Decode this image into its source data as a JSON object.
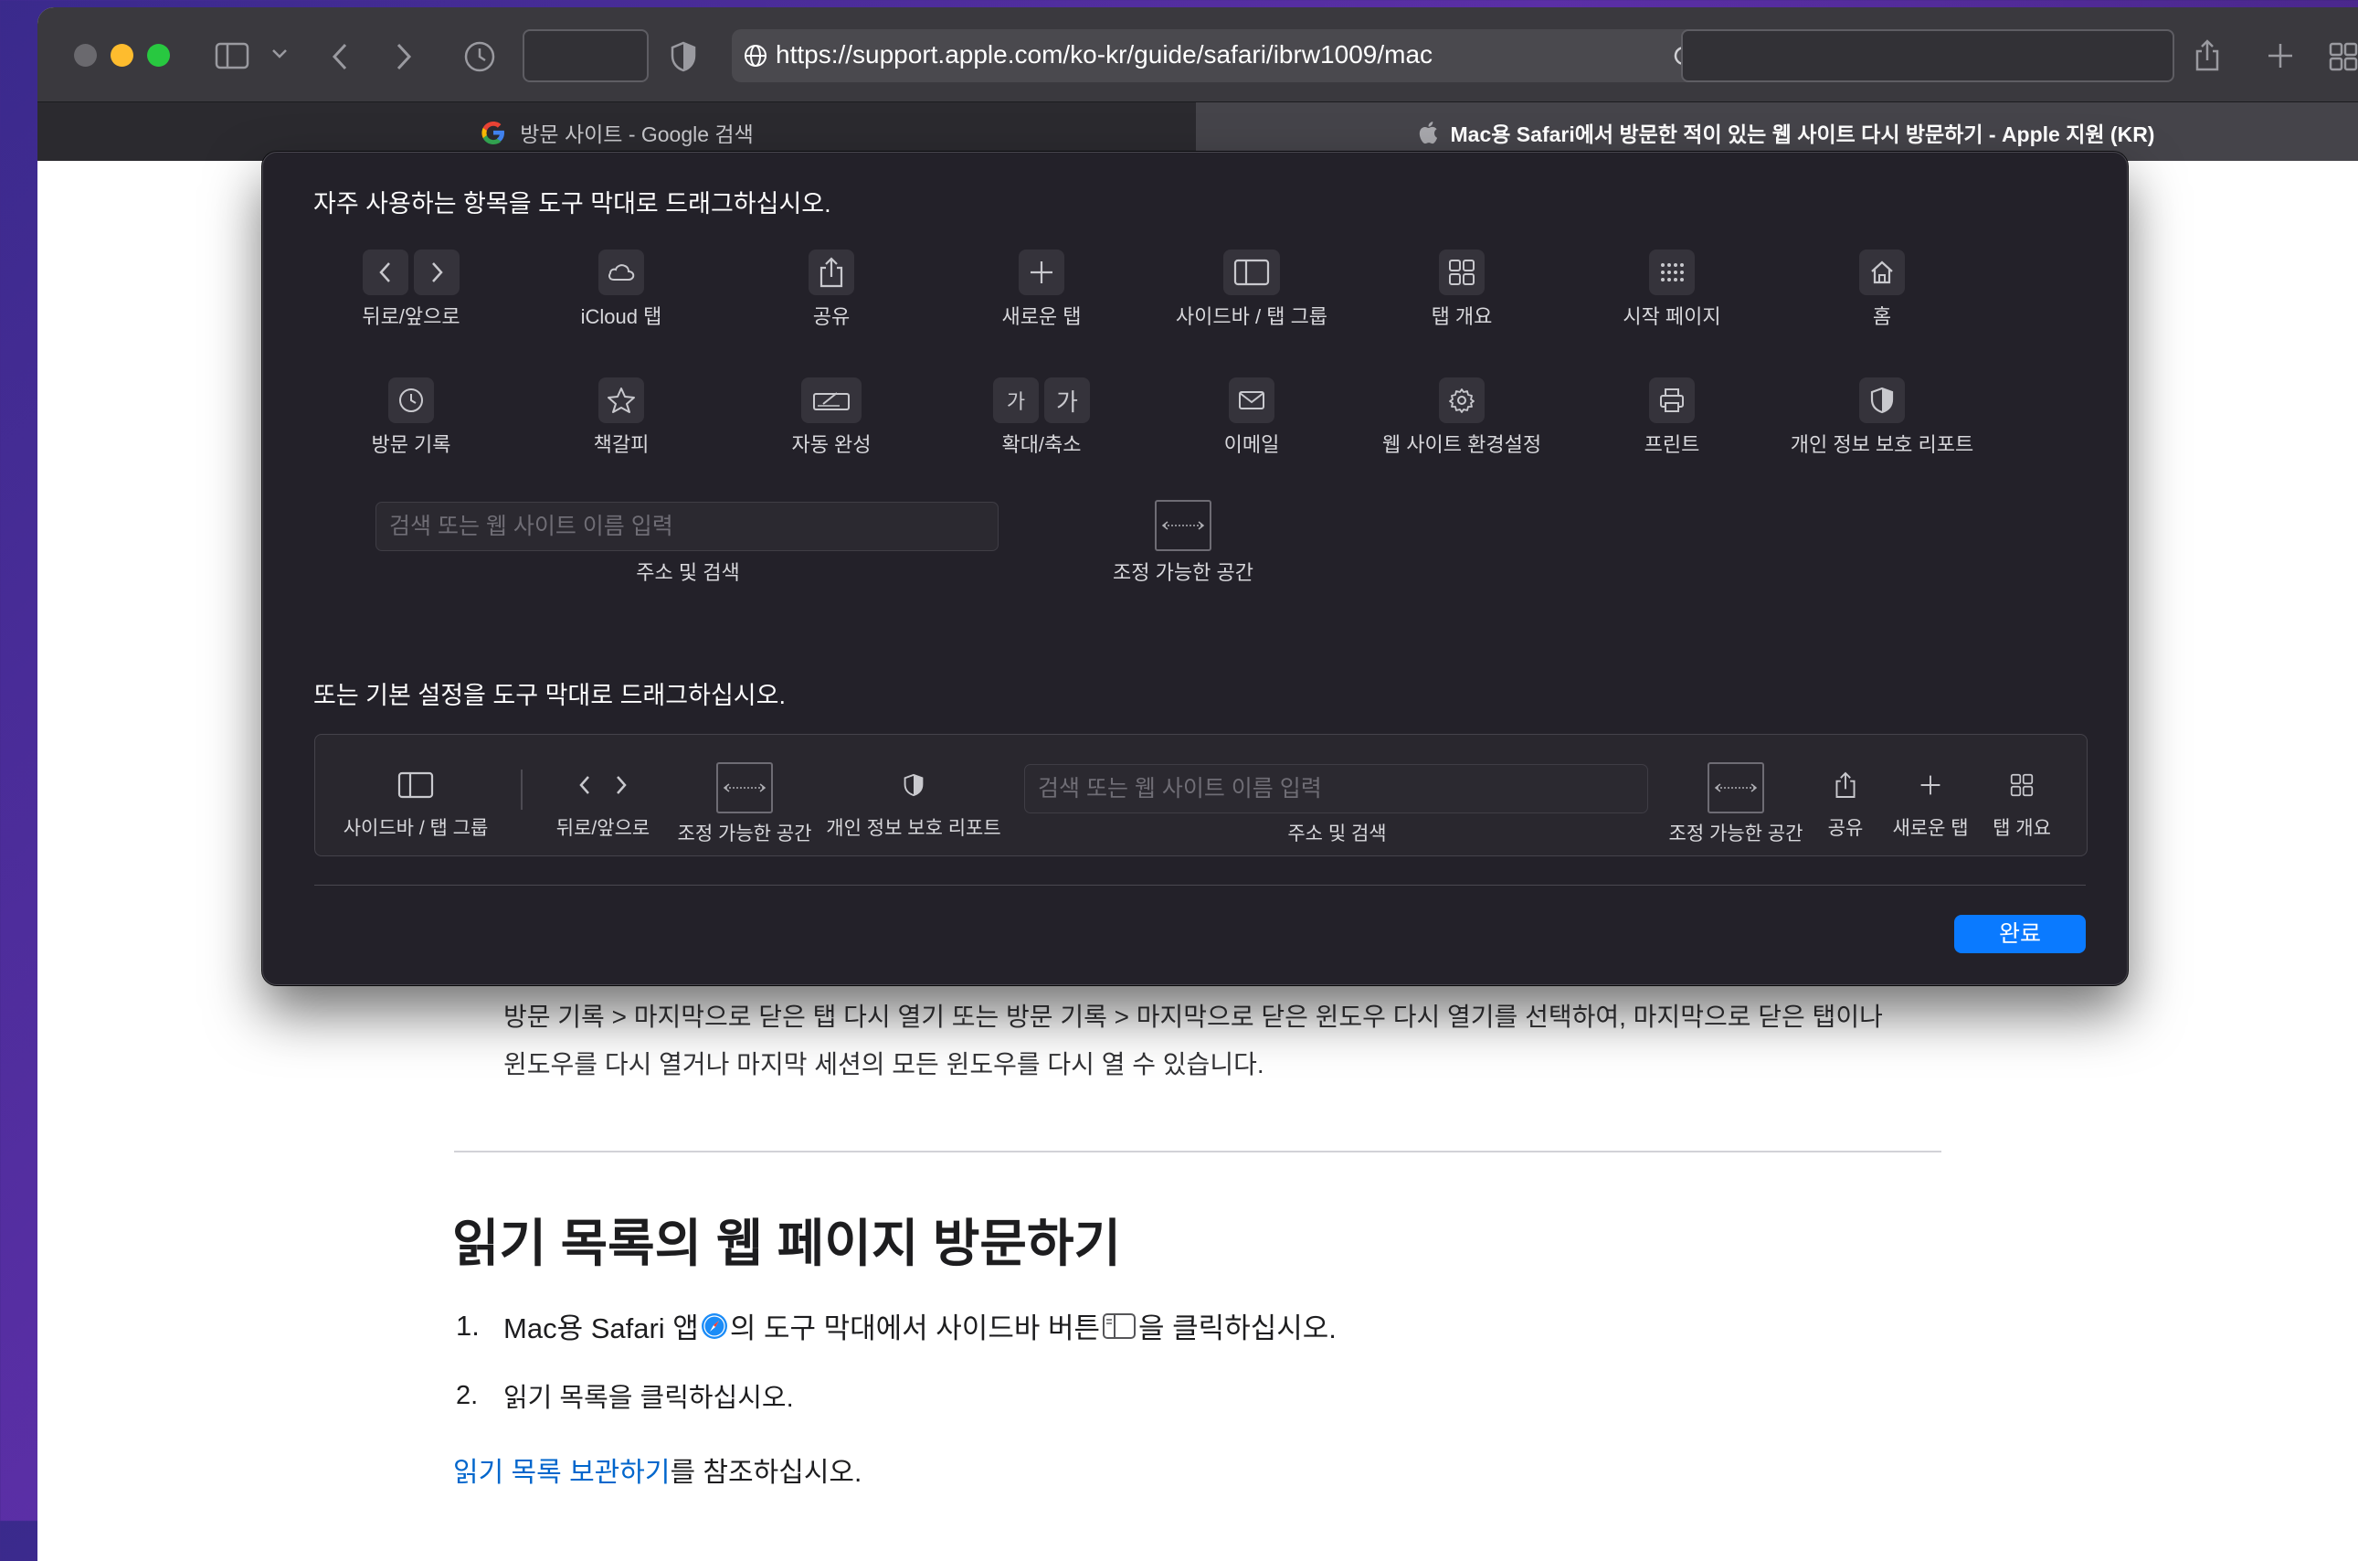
{
  "browser": {
    "url": "https://support.apple.com/ko-kr/guide/safari/ibrw1009/mac",
    "tabs": [
      {
        "label": "방문 사이트 - Google 검색",
        "icon": "google-g-icon",
        "active": false
      },
      {
        "label": "Mac용 Safari에서 방문한 적이 있는 웹 사이트 다시 방문하기 - Apple 지원 (KR)",
        "icon": "apple-logo-icon",
        "active": true
      }
    ]
  },
  "customize": {
    "prompt": "자주 사용하는 항목을 도구 막대로 드래그하십시오.",
    "items": [
      {
        "label": "뒤로/앞으로",
        "icon": "back-forward-icon"
      },
      {
        "label": "iCloud 탭",
        "icon": "icloud-icon"
      },
      {
        "label": "공유",
        "icon": "share-icon"
      },
      {
        "label": "새로운 탭",
        "icon": "plus-icon"
      },
      {
        "label": "사이드바 / 탭 그룹",
        "icon": "sidebar-icon"
      },
      {
        "label": "탭 개요",
        "icon": "tab-overview-icon"
      },
      {
        "label": "시작 페이지",
        "icon": "start-page-icon"
      },
      {
        "label": "홈",
        "icon": "home-icon"
      },
      {
        "label": "방문 기록",
        "icon": "history-icon"
      },
      {
        "label": "책갈피",
        "icon": "bookmark-star-icon"
      },
      {
        "label": "자동 완성",
        "icon": "autofill-icon"
      },
      {
        "label": "확대/축소",
        "icon": "zoom-icon"
      },
      {
        "label": "이메일",
        "icon": "mail-icon"
      },
      {
        "label": "웹 사이트 환경설정",
        "icon": "gear-icon"
      },
      {
        "label": "프린트",
        "icon": "print-icon"
      },
      {
        "label": "개인 정보 보호 리포트",
        "icon": "privacy-shield-icon"
      }
    ],
    "zoom_glyph": "가",
    "search_placeholder": "검색 또는 웹 사이트 이름 입력",
    "search_label": "주소 및 검색",
    "flexible_space_label": "조정 가능한 공간",
    "default_prompt": "또는 기본 설정을 도구 막대로 드래그하십시오.",
    "default_set": {
      "sidebar_label": "사이드바 / 탭 그룹",
      "back_forward_label": "뒤로/앞으로",
      "flex_space_label": "조정 가능한 공간",
      "privacy_label": "개인 정보 보호 리포트",
      "search_placeholder": "검색 또는 웹 사이트 이름 입력",
      "search_label": "주소 및 검색",
      "flex_space_label_2": "조정 가능한 공간",
      "share_label": "공유",
      "new_tab_label": "새로운 탭",
      "tab_overview_label": "탭 개요"
    },
    "done_label": "완료"
  },
  "page": {
    "paragraph_line1": "방문 기록 > 마지막으로 닫은 탭 다시 열기 또는 방문 기록 > 마지막으로 닫은 윈도우 다시 열기를 선택하여, 마지막으로 닫은 탭이나",
    "paragraph_line2": "윈도우를 다시 열거나 마지막 세션의 모든 윈도우를 다시 열 수 있습니다.",
    "section_heading": "읽기 목록의 웹 페이지 방문하기",
    "step1_num": "1.",
    "step1_a": "Mac용 Safari 앱",
    "step1_b": "의 도구 막대에서 사이드바 버튼",
    "step1_c": "을 클릭하십시오.",
    "step2_num": "2.",
    "step2": "읽기 목록을 클릭하십시오.",
    "see_also_link": "읽기 목록 보관하기",
    "see_also_suffix": "를 참조하십시오."
  },
  "colors": {
    "accent": "#0a7aff",
    "link": "#0066cc",
    "close": "#ff5f57",
    "minimize": "#febc2e",
    "zoom": "#28c840"
  }
}
